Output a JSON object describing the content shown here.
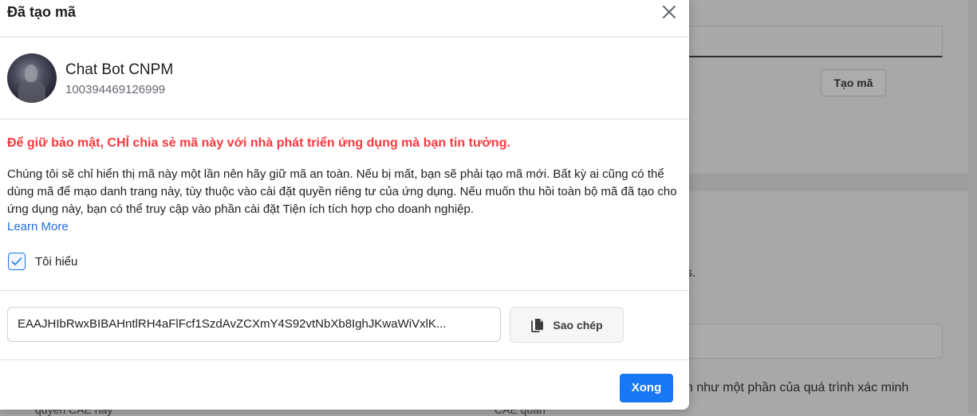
{
  "background": {
    "create_button_label": "Tạo mã",
    "partial_text_s": "s.",
    "partial_text_verify": "n như một phần của quá trình xác minh",
    "bottom_left_text": "quyền CAE này",
    "bottom_mid_text": "CAE quản"
  },
  "modal": {
    "title": "Đã tạo mã",
    "profile": {
      "name": "Chat Bot CNPM",
      "id": "100394469126999"
    },
    "warning": "Để giữ bảo mật, CHỈ chia sẻ mã này với nhà phát triển ứng dụng mà bạn tin tưởng.",
    "description": "Chúng tôi sẽ chỉ hiển thị mã này một lần nên hãy giữ mã an toàn. Nếu bị mất, bạn sẽ phải tạo mã mới. Bất kỳ ai cũng có thể dùng mã để mạo danh trang này, tùy thuộc vào cài đặt quyền riêng tư của ứng dụng. Nếu muốn thu hồi toàn bộ mã đã tạo cho ứng dụng này, bạn có thể truy cập vào phần cài đặt Tiện ích tích hợp cho doanh nghiệp.",
    "learn_more": "Learn More",
    "checkbox": {
      "label": "Tôi hiểu",
      "checked": true
    },
    "token": "EAAJHIbRwxBIBAHntlRH4aFlFcf1SzdAvZCXmY4S92vtNbXb8IghJKwaWiVxlK...",
    "copy_button": "Sao chép",
    "done_button": "Xong"
  },
  "colors": {
    "warning": "#fa383e",
    "link": "#216fdb",
    "primary": "#1877f2"
  }
}
